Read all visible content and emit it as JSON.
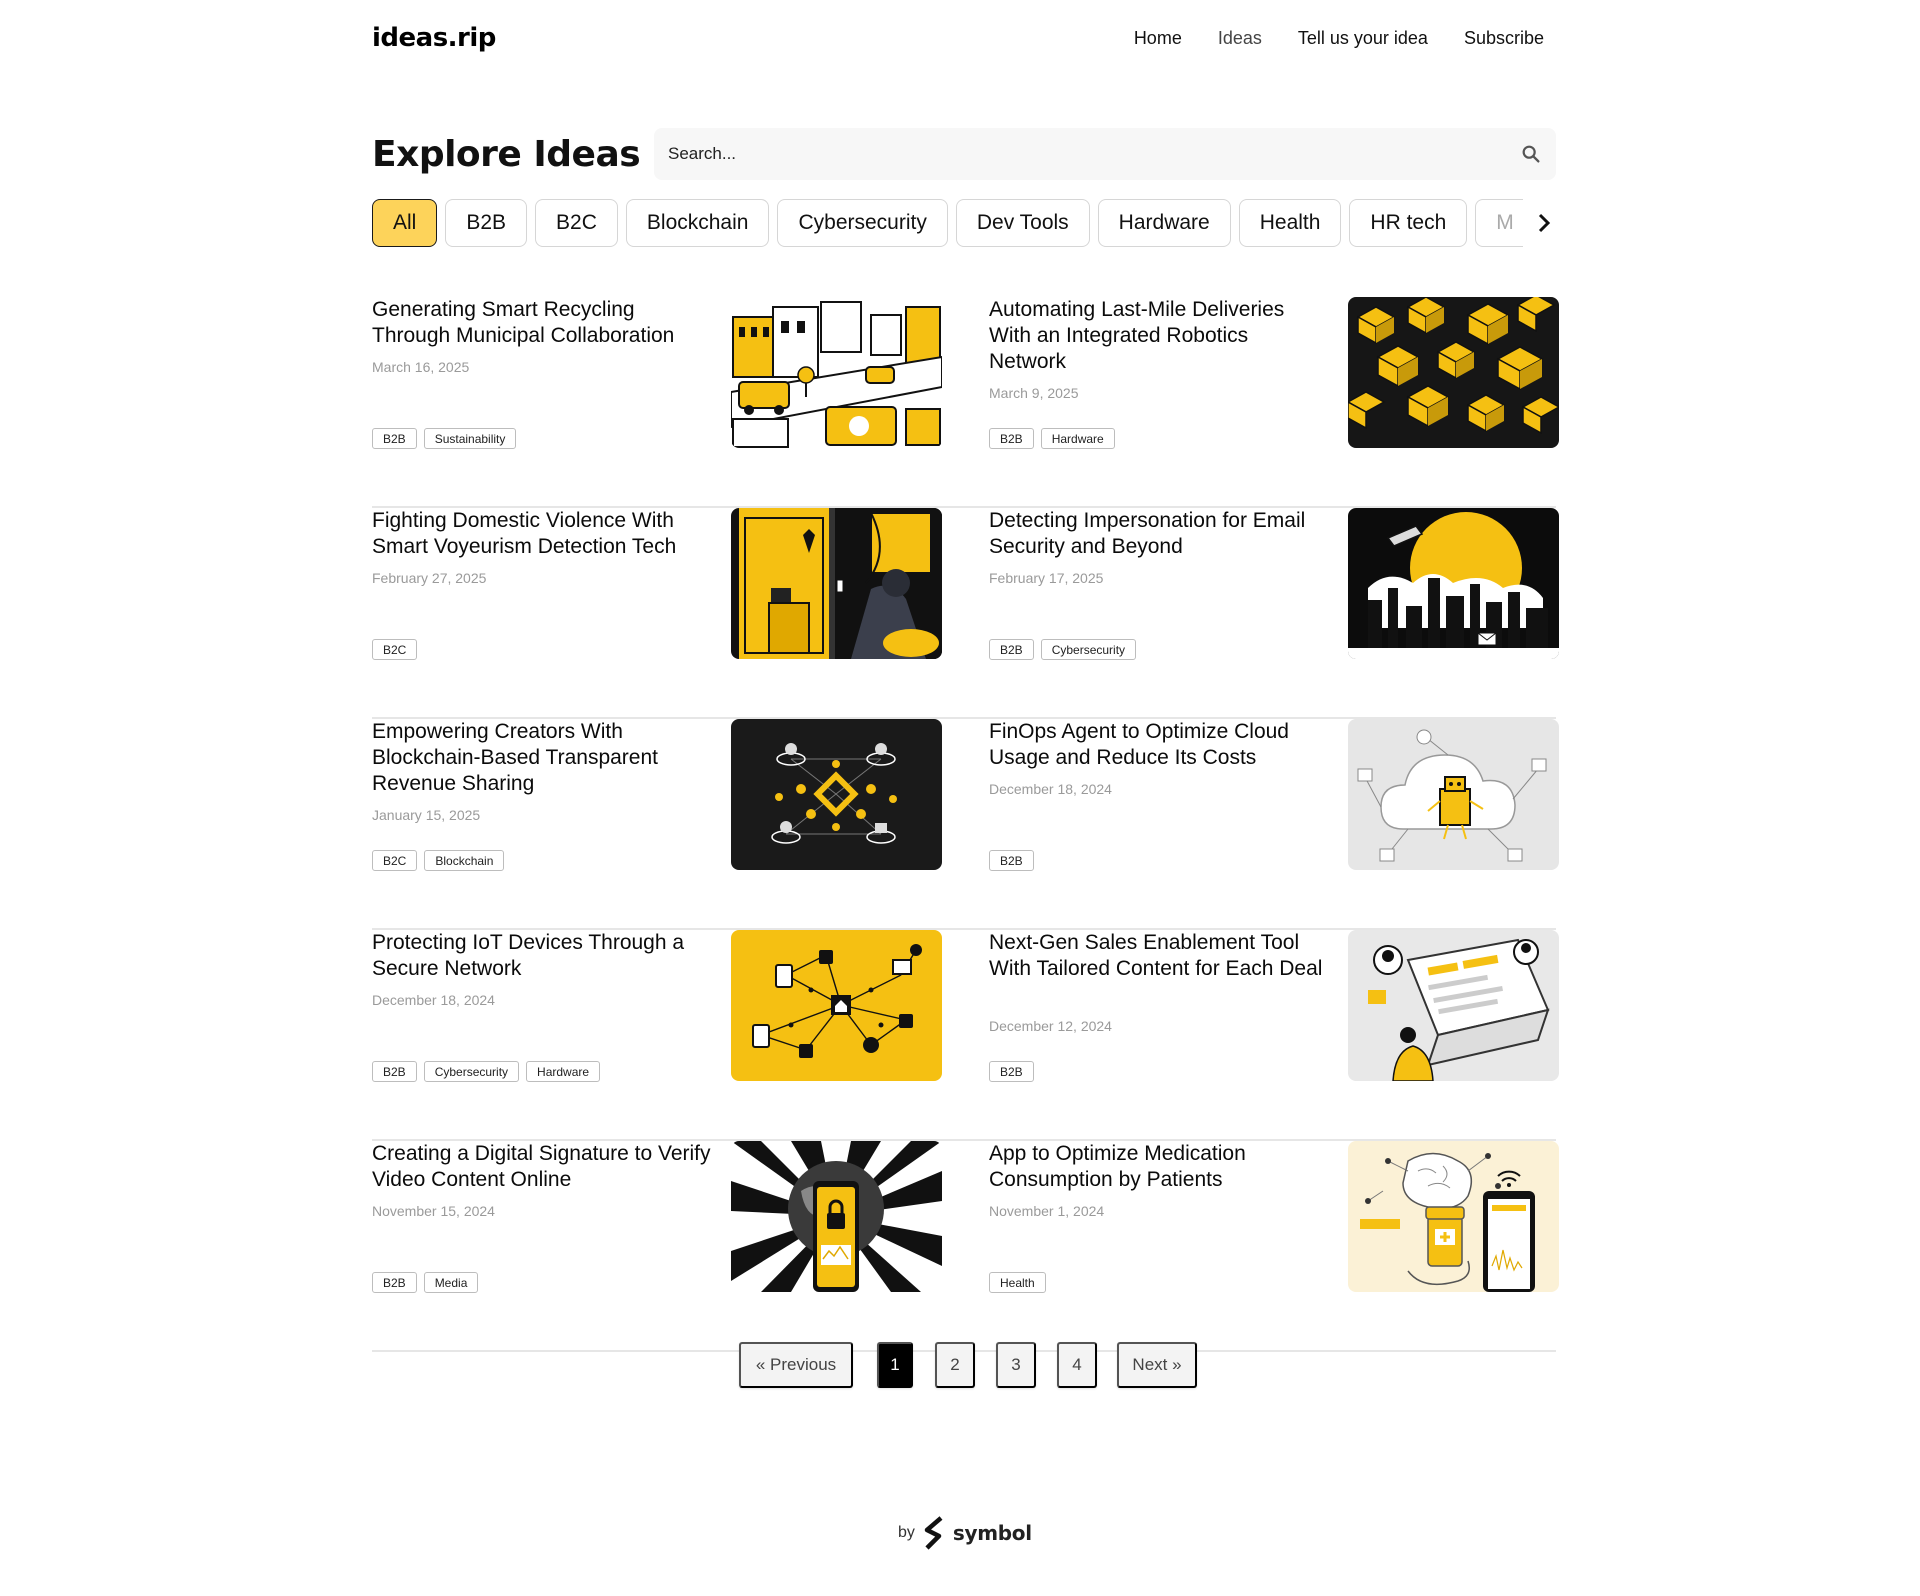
{
  "header": {
    "logo": "ideas.rip",
    "nav": [
      "Home",
      "Ideas",
      "Tell us your idea",
      "Subscribe"
    ]
  },
  "explore": {
    "title": "Explore Ideas",
    "search_placeholder": "Search..."
  },
  "filters": [
    "All",
    "B2B",
    "B2C",
    "Blockchain",
    "Cybersecurity",
    "Dev Tools",
    "Hardware",
    "Health",
    "HR tech",
    "M"
  ],
  "active_filter": "All",
  "cards": [
    {
      "title": "Generating Smart Recycling Through Municipal Collaboration",
      "date": "March 16, 2025",
      "tags": [
        "B2B",
        "Sustainability"
      ],
      "image": "city-recycling-illustration"
    },
    {
      "title": "Automating Last-Mile Deliveries With an Integrated Robotics Network",
      "date": "March 9, 2025",
      "tags": [
        "B2B",
        "Hardware"
      ],
      "image": "robotic-delivery-grid-illustration"
    },
    {
      "title": "Fighting Domestic Violence With Smart Voyeurism Detection Tech",
      "date": "February 27, 2025",
      "tags": [
        "B2C"
      ],
      "image": "room-door-illustration"
    },
    {
      "title": "Detecting Impersonation for Email Security and Beyond",
      "date": "February 17, 2025",
      "tags": [
        "B2B",
        "Cybersecurity"
      ],
      "image": "city-surveillance-illustration"
    },
    {
      "title": "Empowering Creators With Blockchain-Based Transparent Revenue Sharing",
      "date": "January 15, 2025",
      "tags": [
        "B2C",
        "Blockchain"
      ],
      "image": "blockchain-network-illustration"
    },
    {
      "title": "FinOps Agent to Optimize Cloud Usage and Reduce Its Costs",
      "date": "December 18, 2024",
      "tags": [
        "B2B"
      ],
      "image": "cloud-robot-illustration"
    },
    {
      "title": "Protecting IoT Devices Through a Secure Network",
      "date": "December 18, 2024",
      "tags": [
        "B2B",
        "Cybersecurity",
        "Hardware"
      ],
      "image": "iot-network-illustration"
    },
    {
      "title": "Next-Gen Sales Enablement Tool With Tailored Content for Each Deal",
      "date": "December 12, 2024",
      "tags": [
        "B2B"
      ],
      "image": "sales-laptop-illustration"
    },
    {
      "title": "Creating a Digital Signature to Verify Video Content Online",
      "date": "November 15, 2024",
      "tags": [
        "B2B",
        "Media"
      ],
      "image": "phone-lock-illustration"
    },
    {
      "title": "App to Optimize Medication Consumption by Patients",
      "date": "November 1, 2024",
      "tags": [
        "Health"
      ],
      "image": "medication-app-illustration"
    }
  ],
  "pagination": {
    "previous": "« Previous",
    "pages": [
      "1",
      "2",
      "3",
      "4"
    ],
    "current": "1",
    "next": "Next »"
  },
  "footer": {
    "by": "by",
    "brand": "symbol"
  },
  "colors": {
    "accent": "#fdd35a",
    "illustration_yellow": "#f5c012",
    "ink": "#0b0b0b"
  }
}
